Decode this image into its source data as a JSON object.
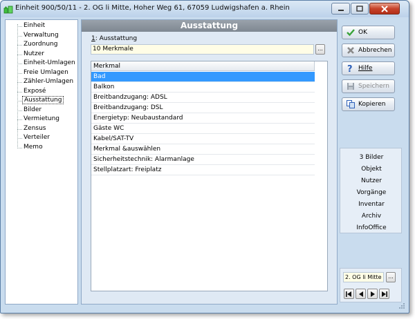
{
  "window": {
    "title": "Einheit 900/50/11 - 2. OG li Mitte, Hoher Weg 61, 67059 Ludwigshafen a. Rhein"
  },
  "tree": {
    "items": [
      {
        "label": "Einheit",
        "selected": false
      },
      {
        "label": "Verwaltung",
        "selected": false
      },
      {
        "label": "Zuordnung",
        "selected": false
      },
      {
        "label": "Nutzer",
        "selected": false
      },
      {
        "label": "Einheit-Umlagen",
        "selected": false
      },
      {
        "label": "Freie Umlagen",
        "selected": false
      },
      {
        "label": "Zähler-Umlagen",
        "selected": false
      },
      {
        "label": "Exposé",
        "selected": false
      },
      {
        "label": "Ausstattung",
        "selected": true
      },
      {
        "label": "Bilder",
        "selected": false
      },
      {
        "label": "Vermietung",
        "selected": false
      },
      {
        "label": "Zensus",
        "selected": false
      },
      {
        "label": "Verteiler",
        "selected": false
      },
      {
        "label": "Memo",
        "selected": false
      }
    ]
  },
  "panel": {
    "title": "Ausstattung",
    "field_label_prefix": "1",
    "field_label_rest": ": Ausstattung",
    "field_value": "10 Merkmale",
    "dots_label": "...",
    "list_header": "Merkmal",
    "rows": [
      "Bad",
      "Balkon",
      "Breitbandzugang: ADSL",
      "Breitbandzugang: DSL",
      "Energietyp: Neubaustandard",
      "Gäste WC",
      "Kabel/SAT-TV",
      "Merkmal &auswählen",
      "Sicherheitstechnik: Alarmanlage",
      "Stellplatzart: Freiplatz"
    ],
    "selected_row": 0
  },
  "buttons": {
    "ok": "OK",
    "cancel": "Abbrechen",
    "help": "Hilfe",
    "save": "Speichern",
    "copy": "Kopieren"
  },
  "links": [
    "3 Bilder",
    "Objekt",
    "Nutzer",
    "Vorgänge",
    "Inventar",
    "Archiv",
    "InfoOffice"
  ],
  "navigator": {
    "current": "2. OG li Mitte",
    "dots_label": "..."
  },
  "colors": {
    "selection": "#3399ff",
    "header_bar": "#8a929b",
    "field_background": "#fffde6"
  }
}
